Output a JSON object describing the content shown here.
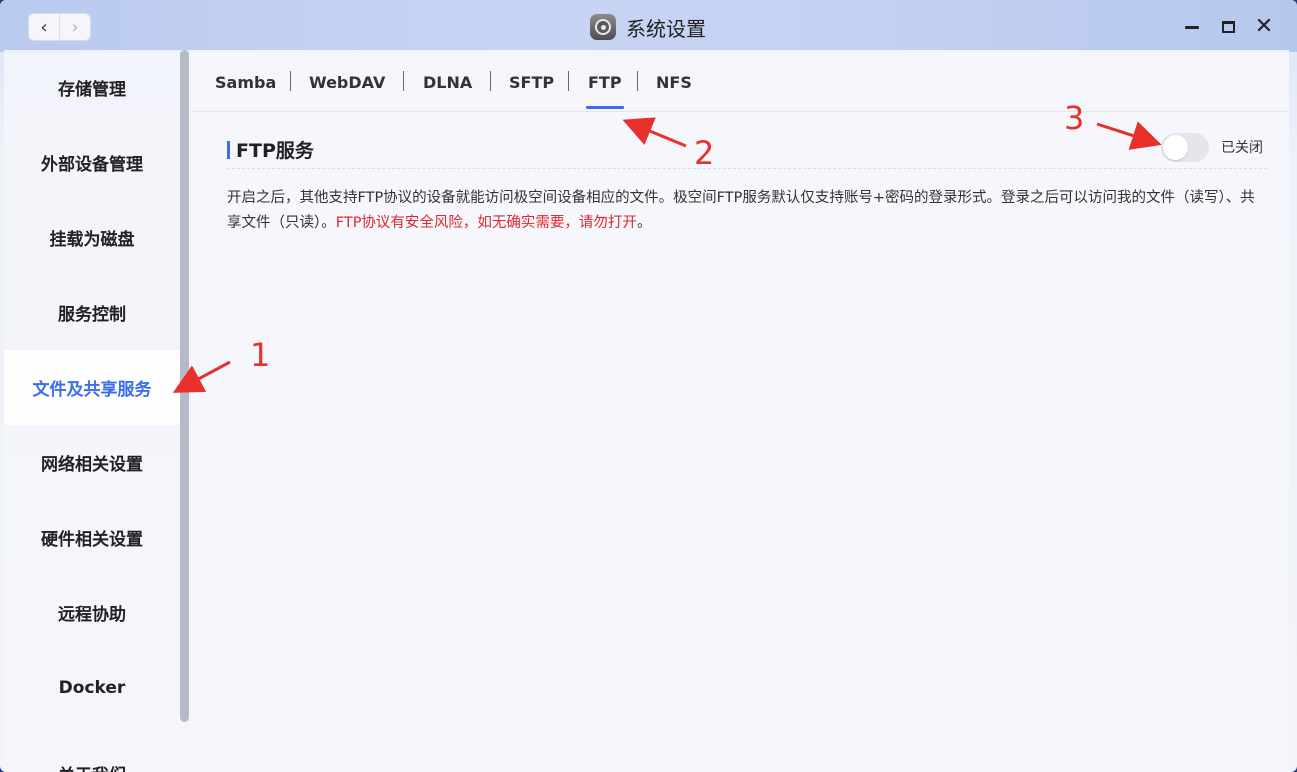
{
  "window": {
    "title": "系统设置",
    "nav_back_icon": "chevron-left-icon",
    "nav_forward_icon": "chevron-right-icon",
    "app_icon": "system-settings-icon",
    "minimize_icon": "minimize-icon",
    "maximize_icon": "maximize-icon",
    "close_icon": "close-icon",
    "close_glyph": "✕"
  },
  "sidebar": {
    "items": [
      {
        "label": "存储管理"
      },
      {
        "label": "外部设备管理"
      },
      {
        "label": "挂载为磁盘"
      },
      {
        "label": "服务控制"
      },
      {
        "label": "文件及共享服务",
        "active": true
      },
      {
        "label": "网络相关设置"
      },
      {
        "label": "硬件相关设置"
      },
      {
        "label": "远程协助"
      },
      {
        "label": "Docker"
      },
      {
        "label": "关于我们"
      }
    ]
  },
  "tabs": [
    {
      "label": "Samba"
    },
    {
      "label": "WebDAV"
    },
    {
      "label": "DLNA"
    },
    {
      "label": "SFTP"
    },
    {
      "label": "FTP",
      "active": true
    },
    {
      "label": "NFS"
    }
  ],
  "ftp": {
    "section_title": "FTP服务",
    "toggle_state": "off",
    "toggle_label": "已关闭",
    "description": "开启之后，其他支持FTP协议的设备就能访问极空间设备相应的文件。极空间FTP服务默认仅支持账号+密码的登录形式。登录之后可以访问我的文件（读写）、共享文件（只读）。",
    "warning": "FTP协议有安全风险，如无确实需要，请勿打开",
    "warning_end": "。"
  },
  "annotations": [
    {
      "label": "1"
    },
    {
      "label": "2"
    },
    {
      "label": "3"
    }
  ],
  "colors": {
    "accent": "#3b6df0",
    "warning": "#e0282e",
    "annotation": "#e8312a"
  }
}
